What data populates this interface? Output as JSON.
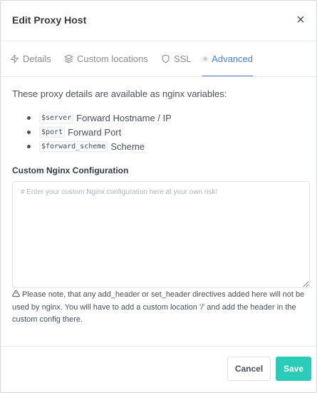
{
  "modal": {
    "title": "Edit Proxy Host",
    "close_glyph": "×"
  },
  "tabs": [
    {
      "label": "Details",
      "icon": "zap-icon",
      "active": false
    },
    {
      "label": "Custom locations",
      "icon": "layers-icon",
      "active": false
    },
    {
      "label": "SSL",
      "icon": "shield-icon",
      "active": false
    },
    {
      "label": "Advanced",
      "icon": "settings-icon",
      "active": true
    }
  ],
  "advanced": {
    "intro": "These proxy details are available as nginx variables:",
    "variables": [
      {
        "code": "$server",
        "desc": "Forward Hostname / IP"
      },
      {
        "code": "$port",
        "desc": "Forward Port"
      },
      {
        "code": "$forward_scheme",
        "desc": "Scheme"
      }
    ],
    "config_label": "Custom Nginx Configuration",
    "config_value": "",
    "config_placeholder": "# Enter your custom Nginx configuration here at your own risk!",
    "warning": "Please note, that any add_header or set_header directives added here will not be used by nginx. You will have to add a custom location '/' and add the header in the custom config there."
  },
  "footer": {
    "cancel_label": "Cancel",
    "save_label": "Save"
  },
  "colors": {
    "accent": "#467fcf",
    "save": "#2bcbba"
  }
}
